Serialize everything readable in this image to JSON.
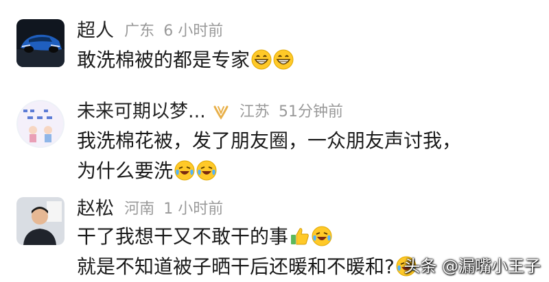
{
  "comments": [
    {
      "username": "超人",
      "location": "广东",
      "time": "6 小时前",
      "lines": [
        "敢洗棉被的都是专家"
      ],
      "emojis": [
        "grin-emoji",
        "grin-emoji"
      ]
    },
    {
      "username": "未来可期以梦...",
      "location": "江苏",
      "time": "51分钟前",
      "lines": [
        "我洗棉花被，发了朋友圈，一众朋友声讨我，",
        "为什么要洗"
      ],
      "emojis": [
        "laugh-cry-emoji",
        "laugh-cry-emoji"
      ]
    },
    {
      "username": "赵松",
      "location": "河南",
      "time": "1 小时前",
      "lines": [
        "干了我想干又不敢干的事",
        "就是不知道被子晒干后还暖和不暖和?"
      ],
      "emojis": [
        "thumbs-up-emoji",
        "laugh-cry-emoji",
        "laugh-cry-emoji"
      ]
    }
  ],
  "watermark": "头条 @漏嘴小王子",
  "colors": {
    "meta_gray": "#999999",
    "vip_gold": "#e8b04a",
    "emoji_yellow": "#ffc928"
  }
}
